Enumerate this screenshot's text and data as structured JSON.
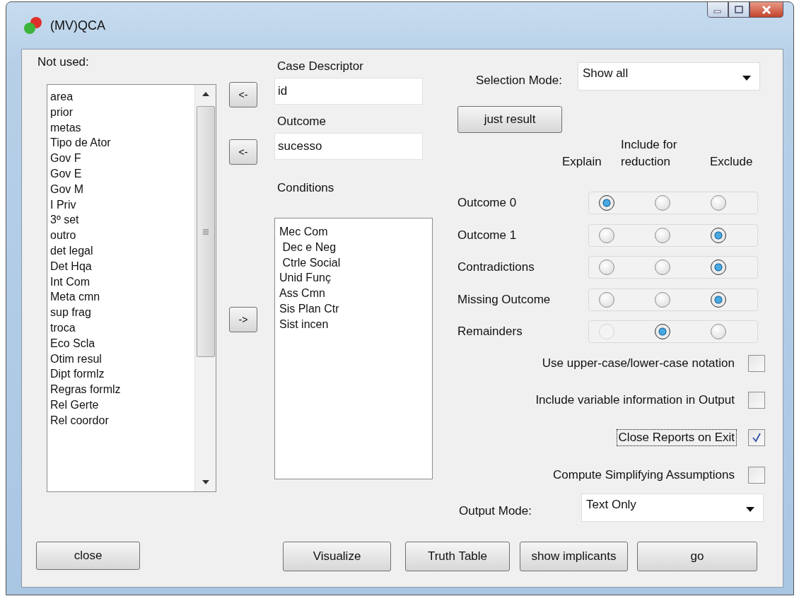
{
  "window": {
    "title": "(MV)QCA"
  },
  "not_used": {
    "label": "Not used:",
    "items": [
      "area",
      "prior",
      "metas",
      "Tipo de Ator",
      "Gov F",
      "Gov E",
      "Gov M",
      "I Priv",
      "3º set",
      "outro",
      "det legal",
      "Det Hqa",
      "Int Com",
      "Meta cmn",
      "sup frag",
      "troca",
      "Eco Scla",
      "Otim resul",
      "Dipt formlz",
      "Regras formlz",
      "Rel Gerte",
      "Rel coordor"
    ]
  },
  "arrow_buttons": [
    "<-",
    "<-",
    "->"
  ],
  "case_descriptor": {
    "label": "Case Descriptor",
    "value": "id"
  },
  "outcome": {
    "label": "Outcome",
    "value": "sucesso"
  },
  "conditions": {
    "label": "Conditions",
    "items": [
      "Mec Com",
      " Dec e Neg",
      " Ctrle Social",
      "Unid Funç",
      "Ass Cmn",
      "Sis Plan Ctr",
      "Sist incen"
    ]
  },
  "selection_mode": {
    "label": "Selection Mode:",
    "value": "Show all"
  },
  "just_result_button": "just result",
  "radio_columns": [
    "Explain",
    "Include for reduction",
    "Exclude"
  ],
  "radio_rows": [
    {
      "label": "Outcome 0",
      "options": [
        {
          "selected": true,
          "disabled": false
        },
        {
          "selected": false,
          "disabled": false
        },
        {
          "selected": false,
          "disabled": false
        }
      ]
    },
    {
      "label": "Outcome 1",
      "options": [
        {
          "selected": false,
          "disabled": false
        },
        {
          "selected": false,
          "disabled": false
        },
        {
          "selected": true,
          "disabled": false
        }
      ]
    },
    {
      "label": "Contradictions",
      "options": [
        {
          "selected": false,
          "disabled": false
        },
        {
          "selected": false,
          "disabled": false
        },
        {
          "selected": true,
          "disabled": false
        }
      ]
    },
    {
      "label": "Missing Outcome",
      "options": [
        {
          "selected": false,
          "disabled": false
        },
        {
          "selected": false,
          "disabled": false
        },
        {
          "selected": true,
          "disabled": false
        }
      ]
    },
    {
      "label": "Remainders",
      "options": [
        {
          "selected": false,
          "disabled": true
        },
        {
          "selected": true,
          "disabled": false
        },
        {
          "selected": false,
          "disabled": false
        }
      ]
    }
  ],
  "checkboxes": [
    {
      "label": "Use upper-case/lower-case notation",
      "checked": false,
      "focused": false
    },
    {
      "label": "Include variable information in Output",
      "checked": false,
      "focused": false
    },
    {
      "label": "Close Reports on Exit",
      "checked": true,
      "focused": true
    },
    {
      "label": "Compute Simplifying Assumptions",
      "checked": false,
      "focused": false
    }
  ],
  "output_mode": {
    "label": "Output Mode:",
    "value": "Text Only"
  },
  "buttons": {
    "close": "close",
    "actions": [
      "Visualize",
      "Truth Table",
      "show implicants",
      "go"
    ]
  }
}
